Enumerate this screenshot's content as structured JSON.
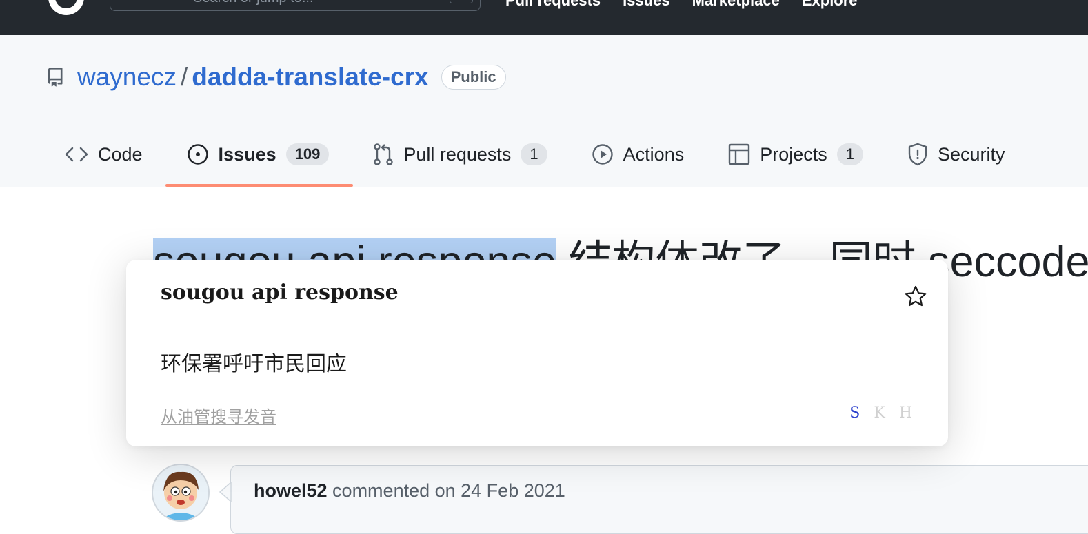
{
  "topbar": {
    "search_placeholder": "Search or jump to...",
    "nav": [
      "Pull requests",
      "Issues",
      "Marketplace",
      "Explore"
    ]
  },
  "repo": {
    "owner": "waynecz",
    "separator": "/",
    "name": "dadda-translate-crx",
    "visibility": "Public"
  },
  "tabs": [
    {
      "label": "Code",
      "icon": "code-icon"
    },
    {
      "label": "Issues",
      "count": "109",
      "icon": "issue-opened-icon",
      "selected": true
    },
    {
      "label": "Pull requests",
      "count": "1",
      "icon": "git-pull-request-icon"
    },
    {
      "label": "Actions",
      "icon": "play-icon"
    },
    {
      "label": "Projects",
      "count": "1",
      "icon": "table-icon"
    },
    {
      "label": "Security",
      "icon": "shield-icon"
    }
  ],
  "issue": {
    "title_selected": "sougou api response",
    "title_rest": " 结构体改了，同时 seccode"
  },
  "comment": {
    "author": "howel52",
    "action": " commented on 24 Feb 2021"
  },
  "popup": {
    "word": "sougou api response",
    "translation": "环保署呼吁市民回应",
    "pronounce_link": "从油管搜寻发音",
    "engines": [
      "S",
      "K",
      "H"
    ],
    "active_engine": "S"
  },
  "colors": {
    "topbar": "#24292f",
    "link": "#2f6bcf",
    "tab_underline": "#fd8c73",
    "selection": "#b3d1f5",
    "active_engine": "#2b3fcc"
  }
}
